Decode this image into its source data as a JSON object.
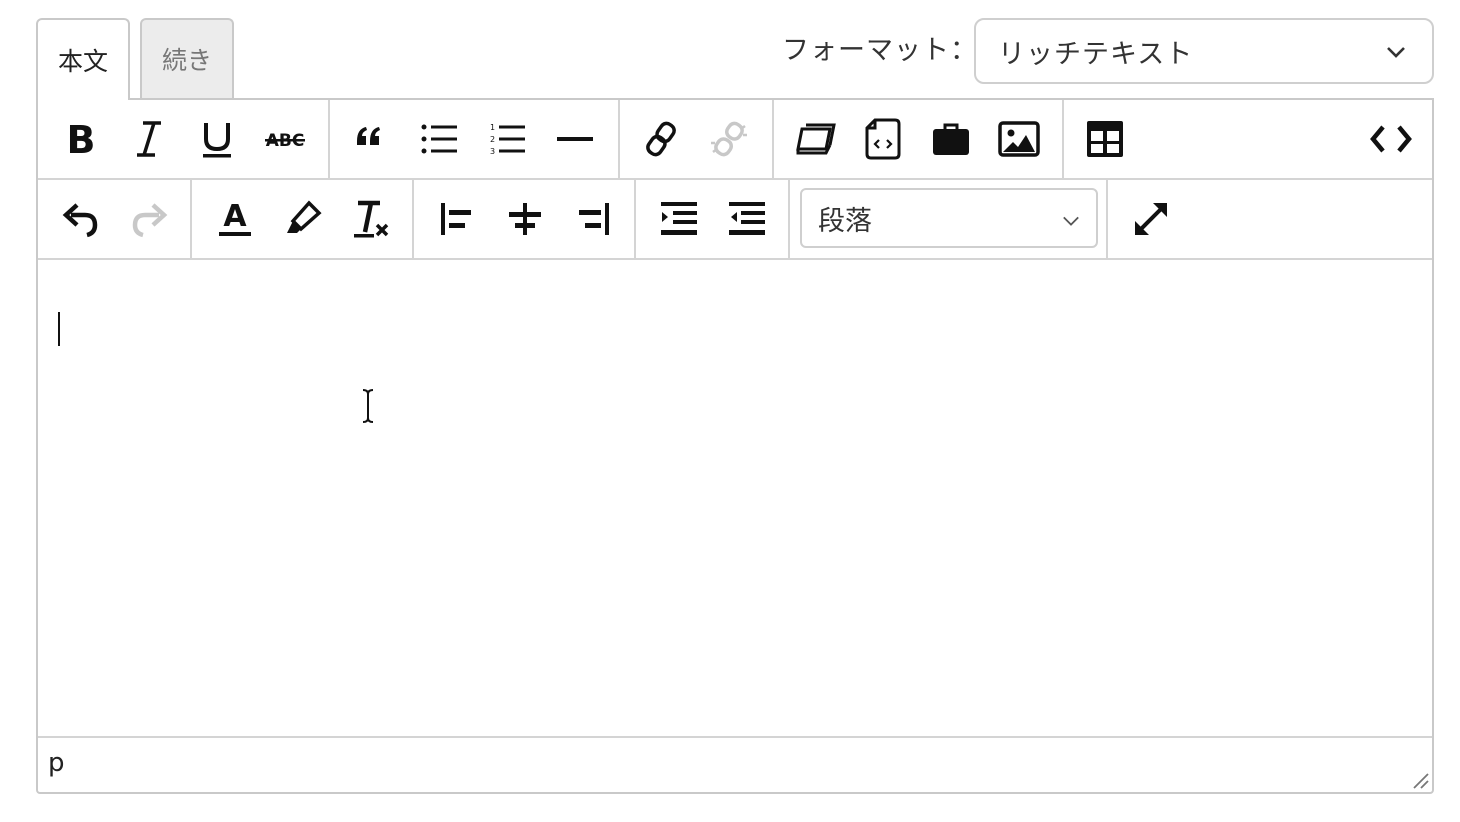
{
  "tabs": [
    {
      "label": "本文",
      "active": true
    },
    {
      "label": "続き",
      "active": false
    }
  ],
  "format": {
    "label": "フォーマット：",
    "selected": "リッチテキスト"
  },
  "toolbar": {
    "row1": [
      "bold-icon",
      "italic-icon",
      "underline-icon",
      "strikethrough-icon",
      "blockquote-icon",
      "bullet-list-icon",
      "numbered-list-icon",
      "horizontal-rule-icon",
      "link-icon",
      "unlink-icon",
      "template-icon",
      "code-file-icon",
      "briefcase-icon",
      "image-icon",
      "table-icon",
      "source-code-icon"
    ],
    "row2": [
      "undo-icon",
      "redo-icon",
      "text-color-icon",
      "highlight-icon",
      "clear-format-icon",
      "align-left-icon",
      "align-center-icon",
      "align-right-icon",
      "indent-icon",
      "outdent-icon",
      "fullscreen-icon"
    ],
    "disabled": [
      "unlink-icon",
      "redo-icon"
    ],
    "block_format": "段落"
  },
  "content": {
    "text": ""
  },
  "status": {
    "path": "p"
  },
  "colors": {
    "icon": "#111111",
    "icon_disabled": "#c8c8c8",
    "border": "#c9c9c9",
    "inactive_tab": "#ececec"
  }
}
